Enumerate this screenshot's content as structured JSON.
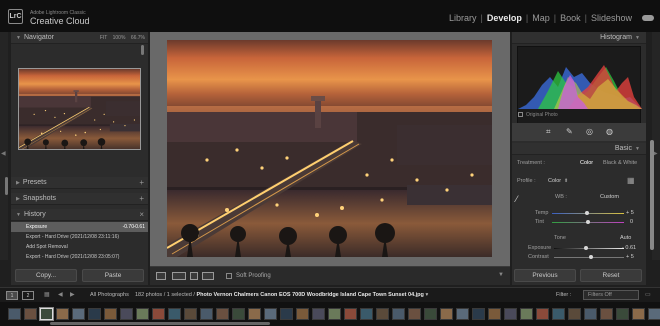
{
  "app": {
    "brand_small": "Adobe Lightroom Classic",
    "brand_big": "Creative Cloud",
    "logo": "LrC",
    "modules": [
      "Library",
      "Develop",
      "Map",
      "Book",
      "Slideshow"
    ],
    "active_module": "Develop"
  },
  "navigator": {
    "title": "Navigator",
    "zoom_fit": "FIT",
    "zoom_100": "100%",
    "zoom_other": "66.7%"
  },
  "presets": {
    "title": "Presets"
  },
  "snapshots": {
    "title": "Snapshots"
  },
  "history": {
    "title": "History",
    "items": [
      {
        "label": "Exposure",
        "v1": "-0.70",
        "v2": "-0.61",
        "selected": true
      },
      {
        "label": "Export - Hard Drive (2021/12/08 23:11:16)",
        "v1": "",
        "v2": "",
        "selected": false
      },
      {
        "label": "Add Spot Removal",
        "v1": "",
        "v2": "",
        "selected": false
      },
      {
        "label": "Export - Hard Drive (2021/12/08 23:05:07)",
        "v1": "",
        "v2": "",
        "selected": false
      }
    ]
  },
  "left_buttons": {
    "copy": "Copy...",
    "paste": "Paste"
  },
  "toolbar": {
    "soft_proofing": "Soft Proofing"
  },
  "histogram": {
    "title": "Histogram",
    "original_photo": "Original Photo"
  },
  "basic": {
    "title": "Basic",
    "treatment_label": "Treatment :",
    "treatment_color": "Color",
    "treatment_bw": "Black & White",
    "profile_label": "Profile :",
    "profile_value": "Color",
    "wb_label": "WB :",
    "wb_value": "Custom",
    "temp_label": "Temp",
    "temp_value": "+ 5",
    "tint_label": "Tint",
    "tint_value": "0",
    "tone_label": "Tone",
    "tone_auto": "Auto",
    "exposure_label": "Exposure",
    "exposure_value": "- 0.61",
    "contrast_label": "Contrast",
    "contrast_value": "+ 5"
  },
  "right_buttons": {
    "previous": "Previous",
    "reset": "Reset"
  },
  "filmbar": {
    "page1": "1",
    "page2": "2",
    "source": "All Photographs",
    "count": "182 photos / 1 selected /",
    "filename": "Photo Vernon Chalmers Canon EOS 700D Woodbridge Island Cape Town Sunset 04.jpg",
    "filter_label": "Filter :",
    "filter_value": "Filters Off"
  },
  "colors": {
    "accent_sky_top": "#6b3a2c",
    "accent_sunset": "#e8944a",
    "panel_bg": "#2c2c2c",
    "topbar_bg": "#0f0f0f"
  }
}
